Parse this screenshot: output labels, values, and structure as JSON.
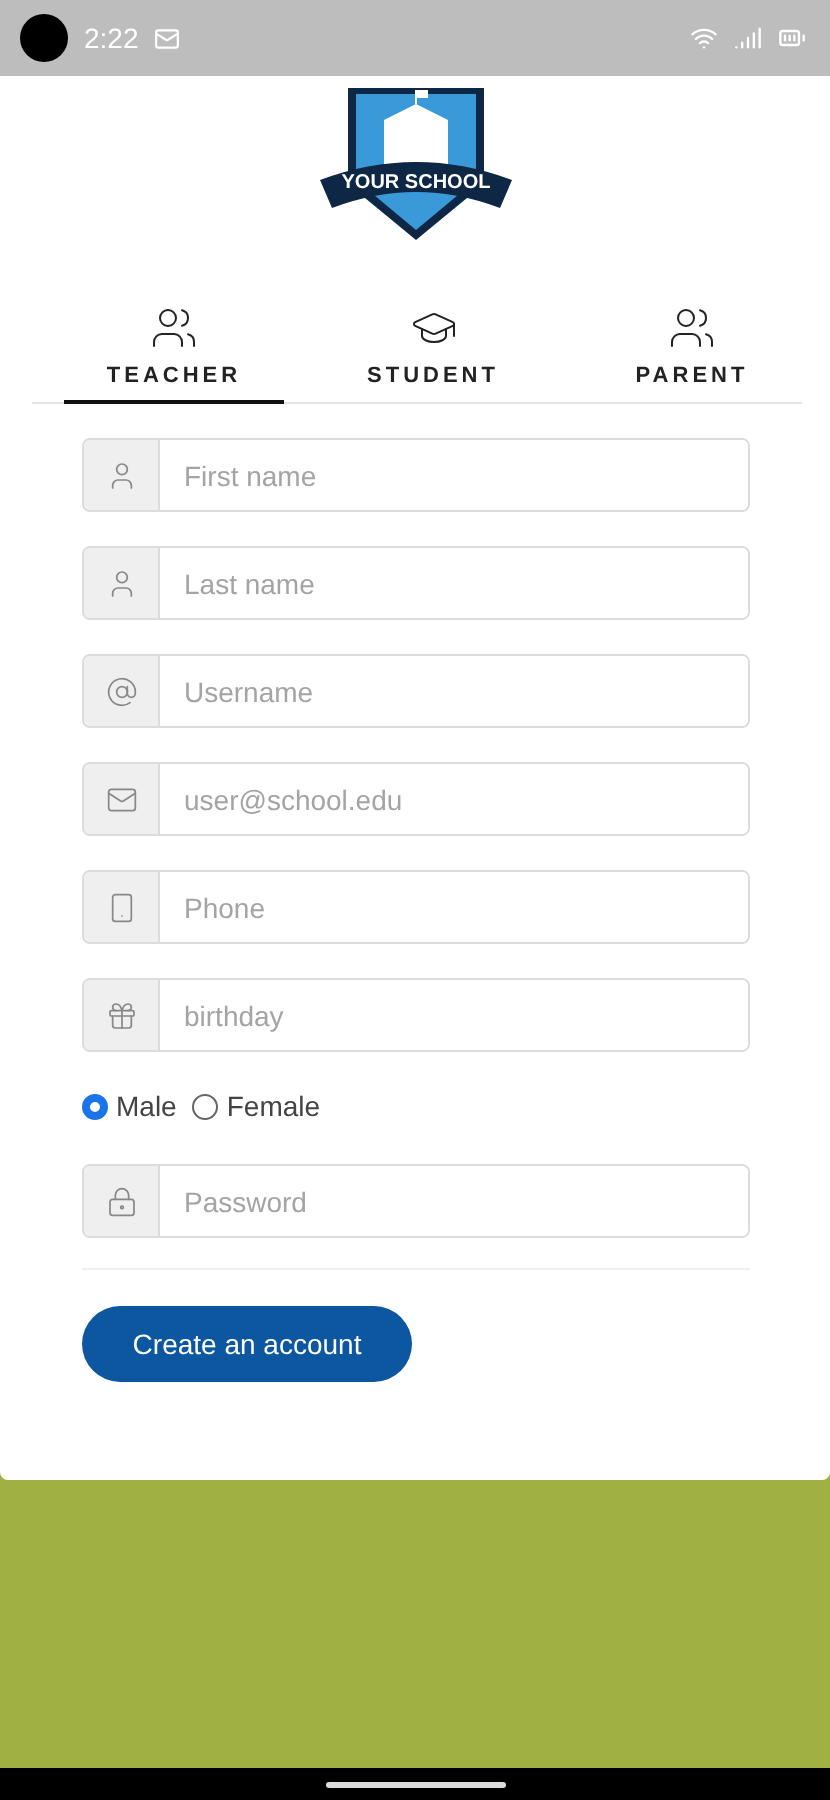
{
  "status_bar": {
    "time": "2:22"
  },
  "logo": {
    "text": "YOUR SCHOOL"
  },
  "tabs": [
    {
      "label": "TEACHER",
      "selected": true
    },
    {
      "label": "STUDENT",
      "selected": false
    },
    {
      "label": "PARENT",
      "selected": false
    }
  ],
  "fields_top": [
    {
      "placeholder": "First name"
    },
    {
      "placeholder": "Last name"
    },
    {
      "placeholder": "Username"
    },
    {
      "placeholder": "user@school.edu"
    },
    {
      "placeholder": "Phone"
    },
    {
      "placeholder": "birthday"
    }
  ],
  "gender": [
    {
      "label": "Male",
      "selected": true
    },
    {
      "label": "Female",
      "selected": false
    }
  ],
  "fields_bottom": [
    {
      "placeholder": "Password"
    }
  ],
  "submit": "Create an account"
}
